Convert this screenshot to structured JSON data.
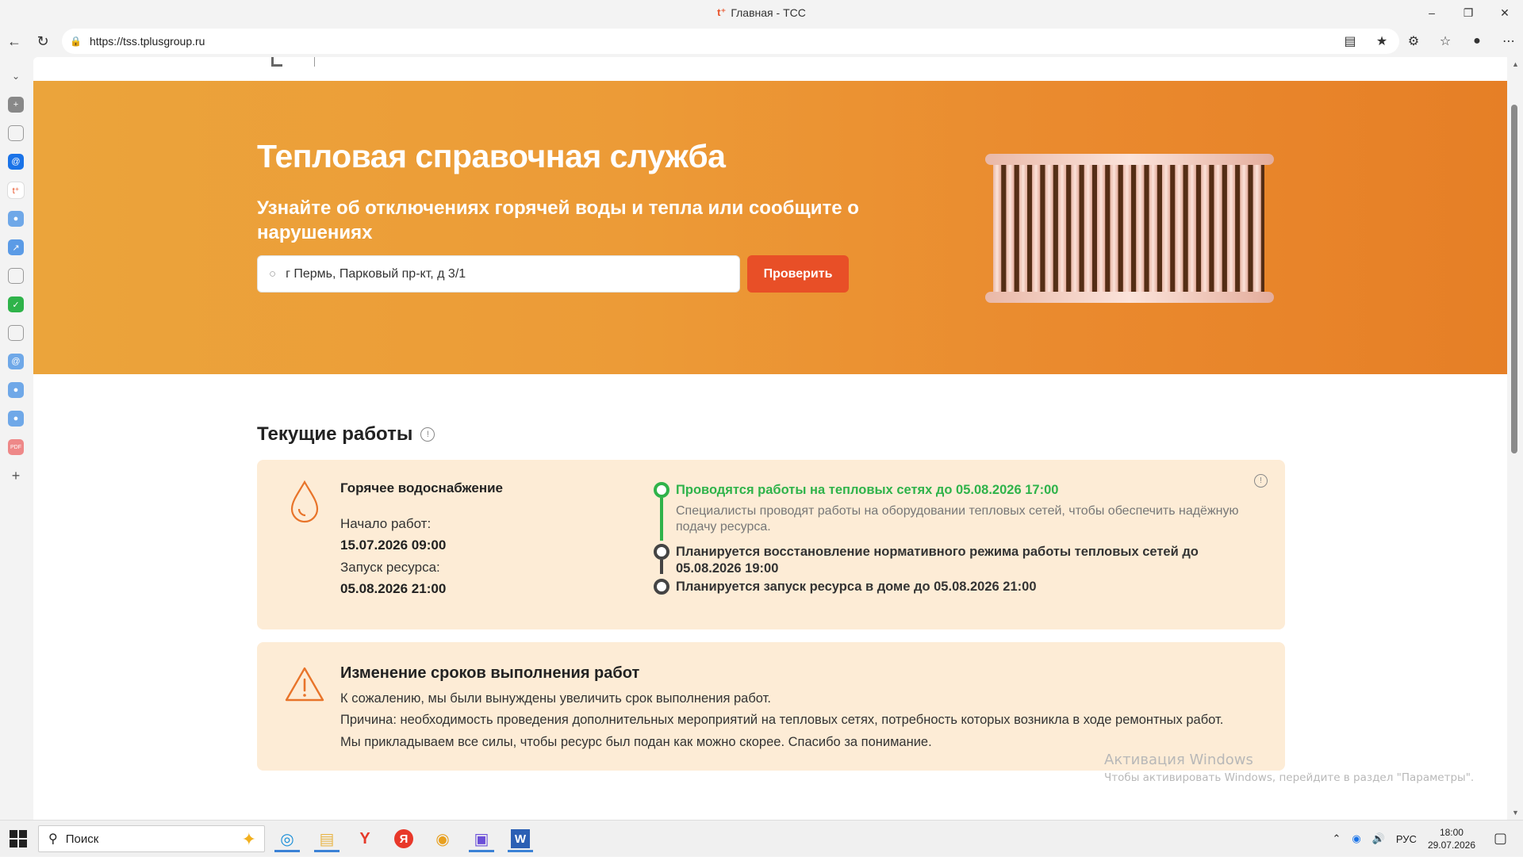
{
  "window": {
    "title": "Главная - ТСС",
    "favicon": "t⁺"
  },
  "browser": {
    "url": "https://tss.tplusgroup.ru"
  },
  "hero": {
    "title": "Тепловая справочная служба",
    "subtitle": "Узнайте об отключениях горячей воды и тепла или сообщите о нарушениях",
    "search_value": "г Пермь, Парковый пр-кт, д 3/1",
    "check_button": "Проверить"
  },
  "current_works": {
    "title": "Текущие работы",
    "card": {
      "title": "Горячее водоснабжение",
      "start_label": "Начало работ:",
      "start_value": "15.07.2026 09:00",
      "launch_label": "Запуск ресурса:",
      "launch_value": "05.08.2026 21:00",
      "timeline": [
        {
          "text": "Проводятся работы на тепловых сетях до 05.08.2026 17:00",
          "desc": "Специалисты проводят работы на оборудовании тепловых сетей, чтобы обеспечить надёжную подачу ресурса.",
          "status": "active"
        },
        {
          "text": "Планируется восстановление нормативного режима работы тепловых сетей до 05.08.2026 19:00",
          "status": "planned"
        },
        {
          "text": "Планируется запуск ресурса в доме до 05.08.2026 21:00",
          "status": "planned"
        }
      ]
    }
  },
  "notice": {
    "title": "Изменение сроков выполнения работ",
    "lines": [
      "К сожалению, мы были вынуждены увеличить срок выполнения работ.",
      "Причина: необходимость проведения дополнительных мероприятий на тепловых сетях, потребность которых возникла в ходе ремонтных работ.",
      "Мы прикладываем все силы, чтобы ресурс был подан как можно скорее. Спасибо за понимание."
    ]
  },
  "watermark": {
    "line1": "Активация Windows",
    "line2": "Чтобы активировать Windows, перейдите в раздел \"Параметры\"."
  },
  "taskbar": {
    "search": "Поиск",
    "lang": "РУС",
    "time": "18:00",
    "date": "29.07.2026"
  },
  "colors": {
    "accent": "#e84f27",
    "hero": "#ec9b37",
    "card": "#fdecd6",
    "success": "#2fb34a"
  }
}
